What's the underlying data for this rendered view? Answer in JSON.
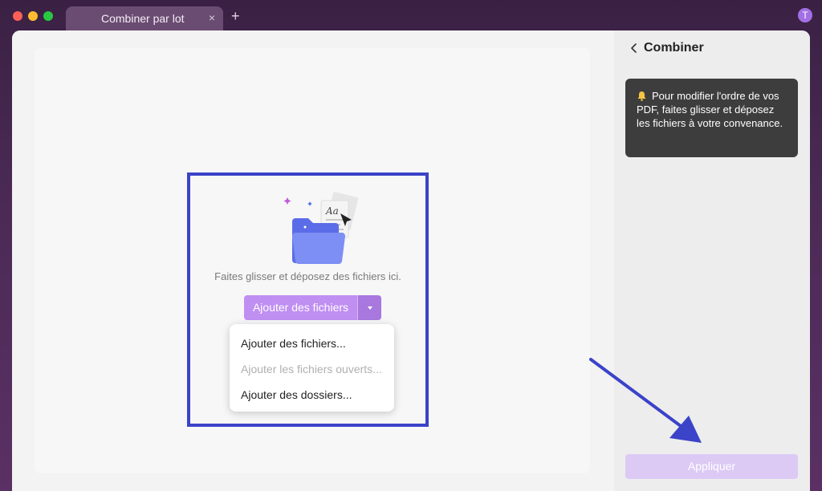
{
  "window": {
    "tab_title": "Combiner par lot",
    "tab_close_glyph": "×",
    "new_tab_glyph": "+",
    "user_initial": "T"
  },
  "drop_zone": {
    "instruction": "Faites glisser et déposez des fichiers ici.",
    "add_files_label": "Ajouter des fichiers",
    "illustration_text": "Aa"
  },
  "dropdown_menu": {
    "items": [
      {
        "label": "Ajouter des fichiers...",
        "disabled": false
      },
      {
        "label": "Ajouter les fichiers ouverts...",
        "disabled": true
      },
      {
        "label": "Ajouter des dossiers...",
        "disabled": false
      }
    ]
  },
  "panel": {
    "title": "Combiner",
    "info_text": "Pour modifier l'ordre de vos PDF, faites glisser et déposez les fichiers à votre convenance.",
    "apply_label": "Appliquer"
  },
  "colors": {
    "accent": "#c08ff2",
    "highlight_border": "#3b43c8",
    "annotation_arrow": "#3b43c8"
  }
}
